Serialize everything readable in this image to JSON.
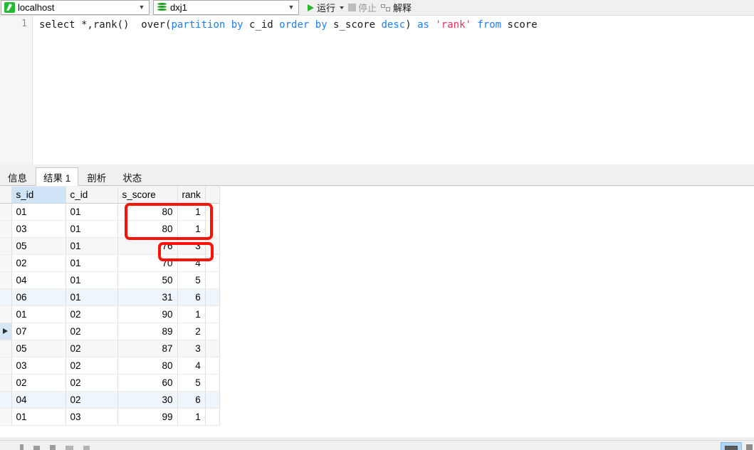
{
  "toolbar": {
    "connection": {
      "value": "localhost",
      "icon": "connection-icon",
      "arrow": "chevron-down-icon"
    },
    "database": {
      "value": "dxj1",
      "icon": "database-icon",
      "arrow": "chevron-down-icon"
    },
    "run_label": "运行",
    "stop_label": "停止",
    "explain_label": "解释"
  },
  "editor": {
    "line_number": "1",
    "code_segments": [
      {
        "t": "select *,rank()  over(",
        "c": "plain"
      },
      {
        "t": "partition",
        "c": "kw"
      },
      {
        "t": " ",
        "c": "plain"
      },
      {
        "t": "by",
        "c": "kw"
      },
      {
        "t": " c_id ",
        "c": "plain"
      },
      {
        "t": "order",
        "c": "kw"
      },
      {
        "t": " ",
        "c": "plain"
      },
      {
        "t": "by",
        "c": "kw"
      },
      {
        "t": " s_score ",
        "c": "plain"
      },
      {
        "t": "desc",
        "c": "kw"
      },
      {
        "t": ") ",
        "c": "plain"
      },
      {
        "t": "as",
        "c": "kw"
      },
      {
        "t": " ",
        "c": "plain"
      },
      {
        "t": "'rank'",
        "c": "str"
      },
      {
        "t": " ",
        "c": "plain"
      },
      {
        "t": "from",
        "c": "kw"
      },
      {
        "t": " score",
        "c": "plain"
      }
    ],
    "code_plain": "select *,rank()  over(partition by c_id order by s_score desc) as 'rank' from score"
  },
  "result_tabs": [
    {
      "label": "信息",
      "active": false
    },
    {
      "label": "结果 1",
      "active": true
    },
    {
      "label": "剖析",
      "active": false
    },
    {
      "label": "状态",
      "active": false
    }
  ],
  "grid": {
    "columns": [
      "s_id",
      "c_id",
      "s_score",
      "rank"
    ],
    "selected_column": "s_id",
    "current_row_index": 7,
    "rows": [
      {
        "s_id": "01",
        "c_id": "01",
        "s_score": "80",
        "rank": "1",
        "style": ""
      },
      {
        "s_id": "03",
        "c_id": "01",
        "s_score": "80",
        "rank": "1",
        "style": ""
      },
      {
        "s_id": "05",
        "c_id": "01",
        "s_score": "76",
        "rank": "3",
        "style": "stripe"
      },
      {
        "s_id": "02",
        "c_id": "01",
        "s_score": "70",
        "rank": "4",
        "style": ""
      },
      {
        "s_id": "04",
        "c_id": "01",
        "s_score": "50",
        "rank": "5",
        "style": ""
      },
      {
        "s_id": "06",
        "c_id": "01",
        "s_score": "31",
        "rank": "6",
        "style": "tint"
      },
      {
        "s_id": "01",
        "c_id": "02",
        "s_score": "90",
        "rank": "1",
        "style": ""
      },
      {
        "s_id": "07",
        "c_id": "02",
        "s_score": "89",
        "rank": "2",
        "style": "current"
      },
      {
        "s_id": "05",
        "c_id": "02",
        "s_score": "87",
        "rank": "3",
        "style": "stripe"
      },
      {
        "s_id": "03",
        "c_id": "02",
        "s_score": "80",
        "rank": "4",
        "style": ""
      },
      {
        "s_id": "02",
        "c_id": "02",
        "s_score": "60",
        "rank": "5",
        "style": ""
      },
      {
        "s_id": "04",
        "c_id": "02",
        "s_score": "30",
        "rank": "6",
        "style": "tint"
      },
      {
        "s_id": "01",
        "c_id": "03",
        "s_score": "99",
        "rank": "1",
        "style": ""
      }
    ]
  },
  "annotations": [
    {
      "name": "highlight-tied-scores",
      "color": "#fc1208"
    },
    {
      "name": "highlight-skipped-rank",
      "color": "#fc1208"
    }
  ]
}
